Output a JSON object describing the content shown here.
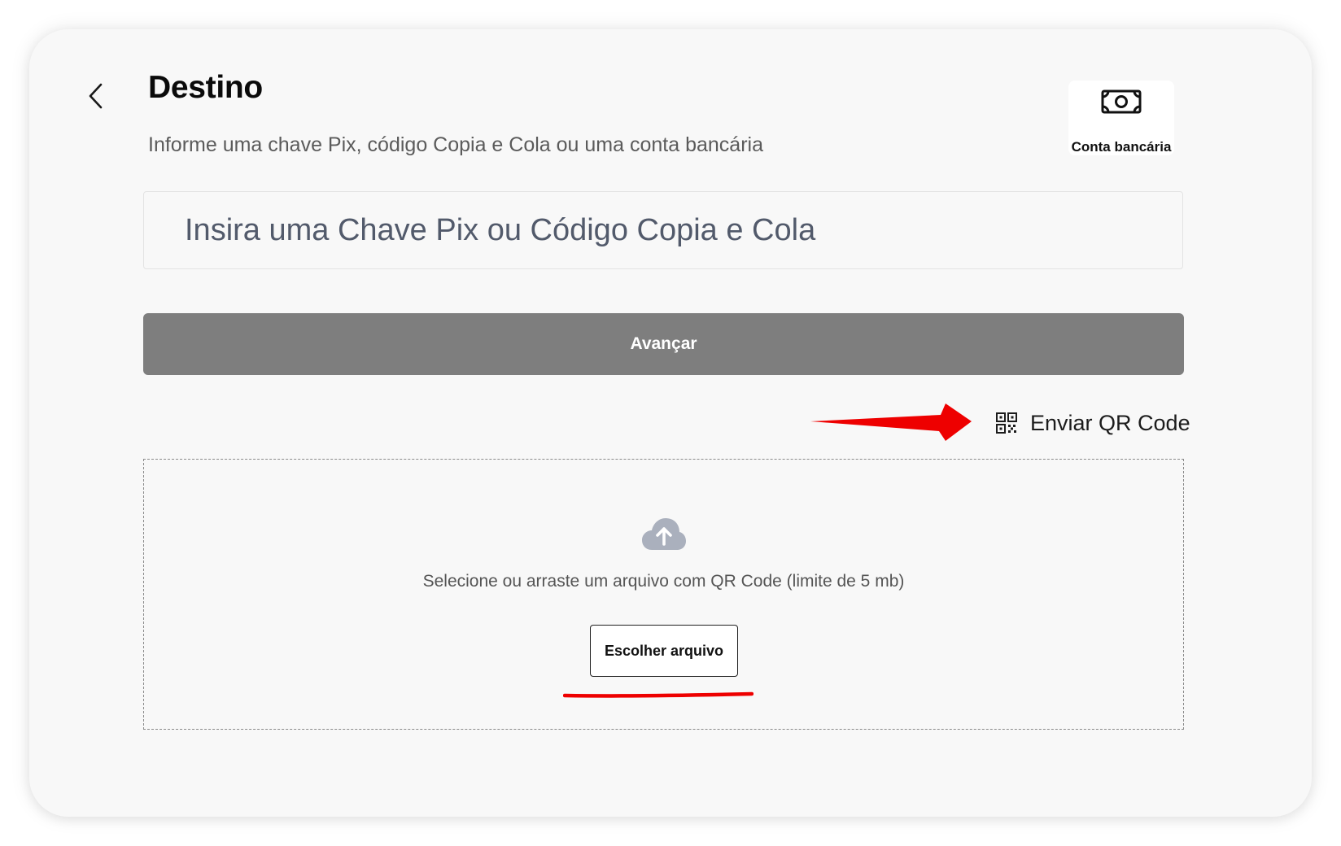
{
  "header": {
    "title": "Destino",
    "subtitle": "Informe uma chave Pix, código Copia e Cola ou uma conta bancária",
    "back_icon": "chevron-left-icon"
  },
  "bank_account": {
    "label": "Conta bancária",
    "icon": "money-bill-icon"
  },
  "key_input": {
    "placeholder": "Insira uma Chave Pix ou Código Copia e Cola",
    "value": ""
  },
  "advance_button": {
    "label": "Avançar",
    "color": "#7e7e7e"
  },
  "qr_link": {
    "label": "Enviar QR Code",
    "icon": "qr-code-icon"
  },
  "dropzone": {
    "icon": "cloud-upload-icon",
    "text": "Selecione ou arraste um arquivo com QR Code (limite de 5 mb)",
    "button_label": "Escolher arquivo"
  },
  "annotations": {
    "color": "#ee0000"
  }
}
